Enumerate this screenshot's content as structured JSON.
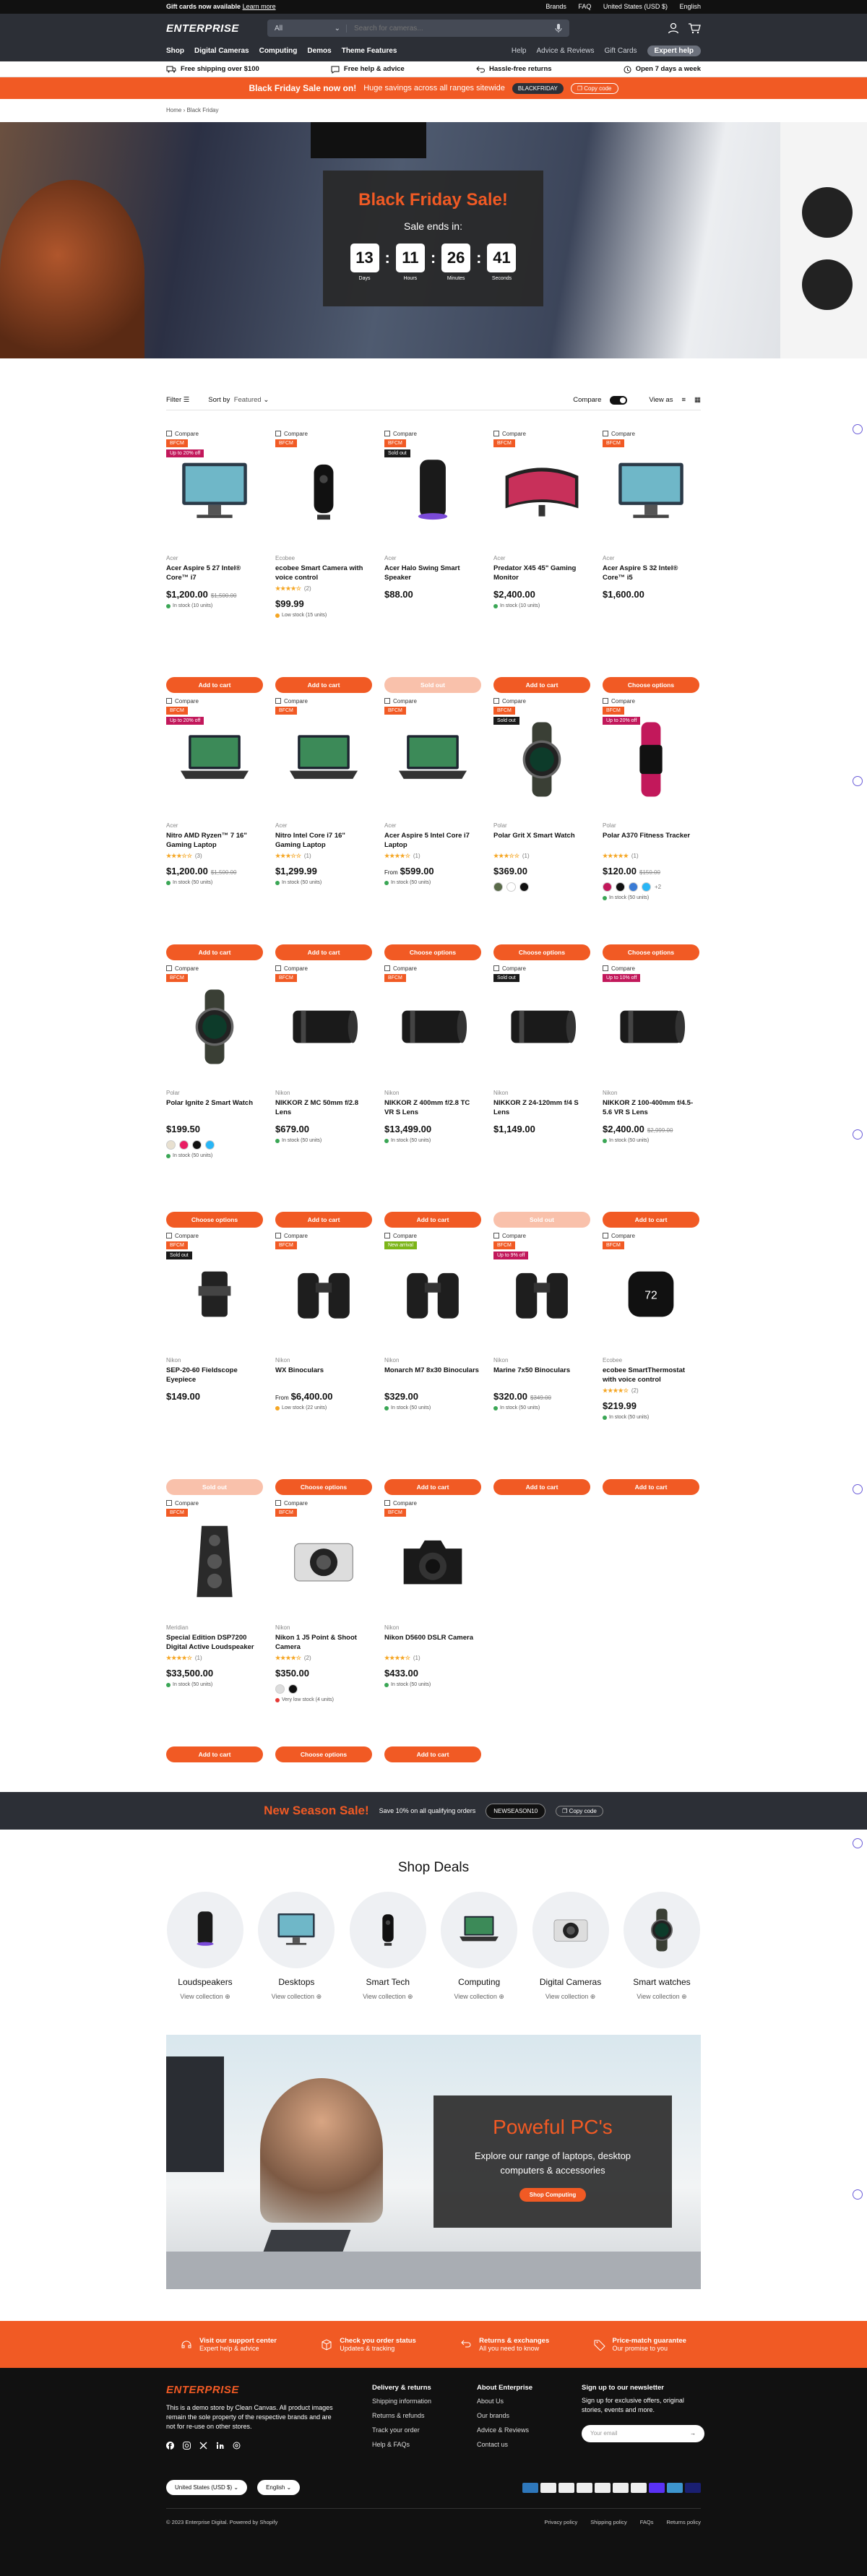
{
  "topbar": {
    "notice": "Gift cards now available",
    "notice_link": "Learn more",
    "links": [
      "Brands",
      "FAQ",
      "United States (USD $)",
      "English"
    ]
  },
  "header": {
    "logo": "ENTERPRISE",
    "search_category": "All",
    "search_placeholder": "Search for cameras...",
    "nav": [
      "Shop",
      "Digital Cameras",
      "Computing",
      "Demos",
      "Theme Features"
    ],
    "nav_right": [
      "Help",
      "Advice & Reviews",
      "Gift Cards"
    ],
    "help_button": "Expert help"
  },
  "benefits": [
    "Free shipping over $100",
    "Free help & advice",
    "Hassle-free returns",
    "Open 7 days a week"
  ],
  "promo": {
    "headline": "Black Friday Sale now on!",
    "text": "Huge savings across all ranges sitewide",
    "code": "BLACKFRIDAY",
    "copy": "Copy code"
  },
  "breadcrumb": [
    "Home",
    "Black Friday"
  ],
  "hero": {
    "title": "Black Friday Sale!",
    "subtitle": "Sale ends in:",
    "countdown": [
      {
        "value": "13",
        "label": "Days"
      },
      {
        "value": "11",
        "label": "Hours"
      },
      {
        "value": "26",
        "label": "Minutes"
      },
      {
        "value": "41",
        "label": "Seconds"
      }
    ]
  },
  "filter": {
    "filter": "Filter",
    "sort_label": "Sort by",
    "sort_value": "Featured",
    "compare": "Compare",
    "view_as": "View as"
  },
  "products": [
    {
      "vendor": "Acer",
      "title": "Acer Aspire 5 27 Intel® Core™ i7",
      "price": "$1,200.00",
      "compare": "$1,500.00",
      "stock": "In stock (10 units)",
      "button": "Add to cart",
      "badges": [
        "BFCM",
        "Up to 20% off"
      ],
      "icon": "desktop-icon"
    },
    {
      "vendor": "Ecobee",
      "title": "ecobee Smart Camera with voice control",
      "stars": "★★★★☆",
      "reviews": "(2)",
      "price": "$99.99",
      "stock": "Low stock (15 units)",
      "stock_level": "low",
      "button": "Add to cart",
      "badges": [
        "BFCM"
      ],
      "icon": "smart-camera-icon"
    },
    {
      "vendor": "Acer",
      "title": "Acer Halo Swing Smart Speaker",
      "price": "$88.00",
      "button": "Sold out",
      "disabled": true,
      "badges": [
        "BFCM",
        "Sold out"
      ],
      "icon": "speaker-icon"
    },
    {
      "vendor": "Acer",
      "title": "Predator X45 45\" Gaming Monitor",
      "price": "$2,400.00",
      "stock": "In stock (10 units)",
      "button": "Add to cart",
      "badges": [
        "BFCM"
      ],
      "icon": "monitor-icon"
    },
    {
      "vendor": "Acer",
      "title": "Acer Aspire S 32 Intel® Core™ i5",
      "price": "$1,600.00",
      "button": "Choose options",
      "badges": [
        "BFCM"
      ],
      "icon": "desktop-icon"
    },
    {
      "vendor": "Acer",
      "title": "Nitro AMD Ryzen™ 7 16\" Gaming Laptop",
      "stars": "★★★☆☆",
      "reviews": "(3)",
      "price": "$1,200.00",
      "compare": "$1,500.00",
      "stock": "In stock (50 units)",
      "button": "Add to cart",
      "badges": [
        "BFCM",
        "Up to 20% off"
      ],
      "icon": "laptop-icon"
    },
    {
      "vendor": "Acer",
      "title": "Nitro Intel Core i7 16\" Gaming Laptop",
      "stars": "★★★☆☆",
      "reviews": "(1)",
      "price": "$1,299.99",
      "stock": "In stock (50 units)",
      "button": "Add to cart",
      "badges": [
        "BFCM"
      ],
      "icon": "laptop-icon"
    },
    {
      "vendor": "Acer",
      "title": "Acer Aspire 5 Intel Core i7 Laptop",
      "stars": "★★★★☆",
      "reviews": "(1)",
      "price_prefix": "From",
      "price": "$599.00",
      "stock": "In stock (50 units)",
      "button": "Choose options",
      "badges": [
        "BFCM"
      ],
      "icon": "laptop-icon"
    },
    {
      "vendor": "Polar",
      "title": "Polar Grit X Smart Watch",
      "stars": "★★★☆☆",
      "reviews": "(1)",
      "price": "$369.00",
      "swatches": [
        "#5a6b4a",
        "#ffffff",
        "#111111"
      ],
      "button": "Choose options",
      "badges": [
        "BFCM",
        "Sold out"
      ],
      "icon": "watch-icon"
    },
    {
      "vendor": "Polar",
      "title": "Polar A370 Fitness Tracker",
      "stars": "★★★★★",
      "reviews": "(1)",
      "price": "$120.00",
      "compare": "$150.00",
      "swatches": [
        "#c2185b",
        "#111111",
        "#3a7bd5",
        "#29b6f6"
      ],
      "swatch_more": "+2",
      "stock": "In stock (50 units)",
      "button": "Choose options",
      "badges": [
        "BFCM",
        "Up to 20% off"
      ],
      "icon": "fitness-tracker-icon"
    },
    {
      "vendor": "Polar",
      "title": "Polar Ignite 2 Smart Watch",
      "price": "$199.50",
      "swatches": [
        "#e8e0d0",
        "#e91e63",
        "#111111",
        "#29b6f6"
      ],
      "stock": "In stock (50 units)",
      "button": "Choose options",
      "badges": [
        "BFCM"
      ],
      "icon": "watch-icon"
    },
    {
      "vendor": "Nikon",
      "title": "NIKKOR Z MC 50mm f/2.8 Lens",
      "price": "$679.00",
      "stock": "In stock (50 units)",
      "button": "Add to cart",
      "badges": [
        "BFCM"
      ],
      "icon": "lens-icon"
    },
    {
      "vendor": "Nikon",
      "title": "NIKKOR Z 400mm f/2.8 TC VR S Lens",
      "price": "$13,499.00",
      "stock": "In stock (50 units)",
      "button": "Add to cart",
      "badges": [
        "BFCM"
      ],
      "icon": "lens-icon"
    },
    {
      "vendor": "Nikon",
      "title": "NIKKOR Z 24-120mm f/4 S Lens",
      "price": "$1,149.00",
      "button": "Sold out",
      "disabled": true,
      "badges": [
        "Sold out"
      ],
      "icon": "lens-icon"
    },
    {
      "vendor": "Nikon",
      "title": "NIKKOR Z 100-400mm f/4.5-5.6 VR S Lens",
      "price": "$2,400.00",
      "compare": "$2,999.00",
      "stock": "In stock (50 units)",
      "button": "Add to cart",
      "badges": [
        "Up to 10% off"
      ],
      "icon": "lens-icon"
    },
    {
      "vendor": "Nikon",
      "title": "SEP-20-60 Fieldscope Eyepiece",
      "price": "$149.00",
      "button": "Sold out",
      "disabled": true,
      "badges": [
        "BFCM",
        "Sold out"
      ],
      "icon": "eyepiece-icon"
    },
    {
      "vendor": "Nikon",
      "title": "WX Binoculars",
      "price_prefix": "From",
      "price": "$6,400.00",
      "stock": "Low stock (22 units)",
      "stock_level": "low",
      "button": "Choose options",
      "badges": [
        "BFCM"
      ],
      "icon": "binoculars-icon"
    },
    {
      "vendor": "Nikon",
      "title": "Monarch M7 8x30 Binoculars",
      "price": "$329.00",
      "stock": "In stock (50 units)",
      "button": "Add to cart",
      "badges": [
        "New arrival"
      ],
      "icon": "binoculars-icon"
    },
    {
      "vendor": "Nikon",
      "title": "Marine 7x50 Binoculars",
      "price": "$320.00",
      "compare": "$349.00",
      "stock": "In stock (50 units)",
      "button": "Add to cart",
      "badges": [
        "BFCM",
        "Up to 9% off"
      ],
      "icon": "binoculars-icon"
    },
    {
      "vendor": "Ecobee",
      "title": "ecobee SmartThermostat with voice control",
      "stars": "★★★★☆",
      "reviews": "(2)",
      "price": "$219.99",
      "stock": "In stock (50 units)",
      "button": "Add to cart",
      "badges": [
        "BFCM"
      ],
      "icon": "thermostat-icon"
    },
    {
      "vendor": "Meridian",
      "title": "Special Edition DSP7200 Digital Active Loudspeaker",
      "stars": "★★★★☆",
      "reviews": "(1)",
      "price": "$33,500.00",
      "stock": "In stock (50 units)",
      "button": "Add to cart",
      "badges": [
        "BFCM"
      ],
      "icon": "loudspeaker-icon"
    },
    {
      "vendor": "Nikon",
      "title": "Nikon 1 J5 Point & Shoot Camera",
      "stars": "★★★★☆",
      "reviews": "(2)",
      "price": "$350.00",
      "swatches": [
        "#dddddd",
        "#111111"
      ],
      "stock": "Very low stock (4 units)",
      "stock_level": "vlow",
      "button": "Choose options",
      "badges": [
        "BFCM"
      ],
      "icon": "camera-icon"
    },
    {
      "vendor": "Nikon",
      "title": "Nikon D5600 DSLR Camera",
      "stars": "★★★★☆",
      "reviews": "(1)",
      "price": "$433.00",
      "stock": "In stock (50 units)",
      "button": "Add to cart",
      "badges": [
        "BFCM"
      ],
      "icon": "dslr-icon"
    }
  ],
  "season": {
    "title": "New Season Sale!",
    "text": "Save 10% on all qualifying orders",
    "code": "NEWSEASON10",
    "copy": "Copy code"
  },
  "deals": {
    "title": "Shop Deals",
    "link": "View collection",
    "items": [
      {
        "name": "Loudspeakers",
        "icon": "speaker-icon"
      },
      {
        "name": "Desktops",
        "icon": "desktop-icon"
      },
      {
        "name": "Smart Tech",
        "icon": "smart-camera-icon"
      },
      {
        "name": "Computing",
        "icon": "laptop-icon"
      },
      {
        "name": "Digital Cameras",
        "icon": "camera-icon"
      },
      {
        "name": "Smart watches",
        "icon": "watch-icon"
      }
    ]
  },
  "pc_banner": {
    "title": "Poweful PC's",
    "text": "Explore our range of laptops, desktop computers & accessories",
    "button": "Shop Computing"
  },
  "support": [
    {
      "title": "Visit our support center",
      "sub": "Expert help & advice"
    },
    {
      "title": "Check you order status",
      "sub": "Updates & tracking"
    },
    {
      "title": "Returns & exchanges",
      "sub": "All you need to know"
    },
    {
      "title": "Price-match guarantee",
      "sub": "Our promise to you"
    }
  ],
  "footer": {
    "logo": "ENTERPRISE",
    "about": "This is a demo store by Clean Canvas. All product images remain the sole property of the respective brands and are not for re-use on other stores.",
    "col1": {
      "title": "Delivery & returns",
      "links": [
        "Shipping information",
        "Returns & refunds",
        "Track your order",
        "Help & FAQs"
      ]
    },
    "col2": {
      "title": "About Enterprise",
      "links": [
        "About Us",
        "Our brands",
        "Advice & Reviews",
        "Contact us"
      ]
    },
    "newsletter": {
      "title": "Sign up to our newsletter",
      "text": "Sign up for exclusive offers, original stories, events and more.",
      "placeholder": "Your email"
    },
    "country": "United States (USD $)",
    "language": "English",
    "copyright": "© 2023 Enterprise Digital. Powered by Shopify",
    "links": [
      "Privacy policy",
      "Shipping policy",
      "FAQs",
      "Returns policy"
    ]
  },
  "colors": {
    "accent": "#f15a24",
    "dark": "#2c2f36"
  }
}
